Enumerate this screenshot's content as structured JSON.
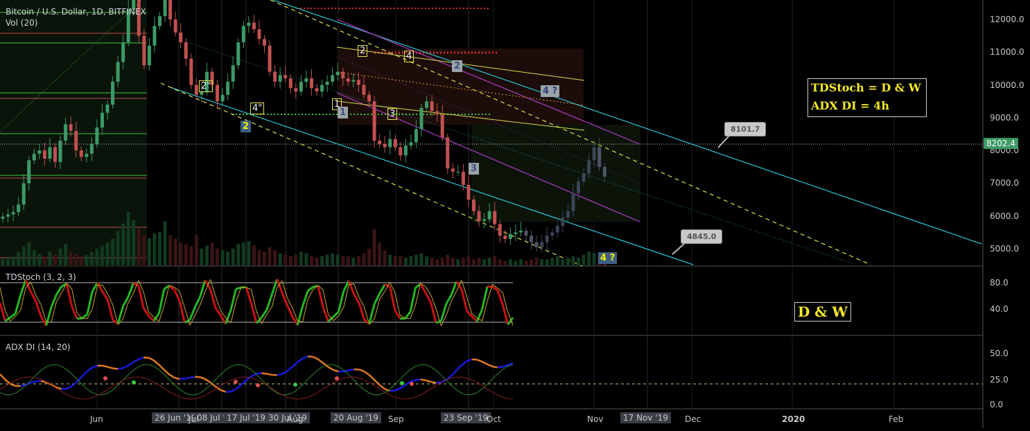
{
  "header": {
    "symbol_title": "Bitcoin / U.S. Dollar, 1D, BITFINEX",
    "vol_label": "Vol (20)"
  },
  "chart_data": [
    {
      "type": "candlestick",
      "title": "Bitcoin / U.S. Dollar, 1D, BITFINEX",
      "y_ticks": [
        "12000.0",
        "11000.0",
        "10000.0",
        "9000.0",
        "8000.0",
        "7000.0",
        "6000.0",
        "5000.0"
      ],
      "ylim": [
        4600,
        12500
      ],
      "last_price": "8202.4",
      "callouts": [
        "8101.7",
        "4845.0"
      ],
      "wave_labels": [
        "2\"",
        "4\"",
        "2",
        "1",
        "1",
        "2",
        "3",
        "4",
        "2",
        "3",
        "4 ?",
        "4 ?"
      ],
      "annotation_box": [
        "TDStoch = D & W",
        "ADX DI = 4h"
      ],
      "series_close": [
        5980,
        6050,
        6120,
        6350,
        7000,
        7700,
        7900,
        8000,
        7750,
        8100,
        7650,
        8300,
        8800,
        8600,
        8000,
        7800,
        7900,
        8200,
        8700,
        9150,
        9400,
        10100,
        10700,
        11300,
        12300,
        12700,
        11500,
        10600,
        11200,
        11800,
        12100,
        12600,
        12000,
        11600,
        11300,
        10800,
        10000,
        9700,
        9800,
        10400,
        10000,
        9500,
        9700,
        10100,
        10600,
        11300,
        11800,
        11900,
        11700,
        11400,
        11200,
        10400,
        10100,
        10300,
        10200,
        9900,
        9800,
        10100,
        10200,
        9900,
        9800,
        10000,
        10100,
        10300,
        10400,
        10200,
        10100,
        10150,
        10000,
        9700,
        9500,
        8300,
        8200,
        8100,
        8350,
        8100,
        7850,
        8150,
        8250,
        8650,
        9300,
        9500,
        9200,
        9100,
        8400,
        7450,
        7350,
        7350,
        6950,
        6500,
        6150,
        5850,
        5900,
        6150,
        5750,
        5400,
        5300,
        5450,
        5500,
        5550,
        5400,
        5200,
        5050,
        5200,
        5400,
        5500,
        5700,
        5950,
        6150,
        6700,
        7050,
        7300,
        7700,
        8100,
        7500,
        7200
      ],
      "volume": [
        8,
        10,
        12,
        18,
        25,
        30,
        20,
        15,
        12,
        18,
        14,
        22,
        28,
        18,
        15,
        12,
        14,
        18,
        22,
        26,
        30,
        35,
        45,
        55,
        70,
        60,
        48,
        40,
        36,
        42,
        44,
        58,
        40,
        35,
        30,
        28,
        25,
        40,
        22,
        26,
        30,
        22,
        20,
        18,
        22,
        28,
        30,
        32,
        26,
        20,
        18,
        24,
        20,
        16,
        14,
        12,
        14,
        18,
        16,
        12,
        10,
        12,
        14,
        16,
        14,
        12,
        12,
        10,
        12,
        16,
        22,
        48,
        30,
        20,
        14,
        12,
        12,
        10,
        12,
        14,
        16,
        12,
        10,
        8,
        10,
        14,
        10,
        8,
        10,
        12,
        8,
        10,
        8,
        10,
        12,
        8,
        6,
        8,
        6,
        8,
        6,
        8,
        10,
        8,
        8,
        10,
        12,
        8,
        10,
        12,
        10,
        14,
        18,
        16,
        12,
        10
      ]
    },
    {
      "type": "line",
      "title": "TDStoch (3, 2, 3)",
      "y_ticks": [
        "80.0",
        "40.0"
      ],
      "annotation_box": [
        "D & W"
      ]
    },
    {
      "type": "line",
      "title": "ADX DI (14, 20)",
      "y_ticks": [
        "50.0",
        "25.0",
        "0.0"
      ]
    }
  ],
  "x_axis": {
    "ticks": [
      "Jun",
      "Jul",
      "Aug",
      "Sep",
      "Oct",
      "Nov",
      "Dec",
      "2020",
      "Feb"
    ],
    "date_chips": [
      "26 Jun '19",
      "08 Jul '19",
      "17 Jul '19",
      "30 Jul '19",
      "20 Aug '19",
      "23 Sep '19",
      "17 Nov '19"
    ]
  },
  "colors": {
    "bull_candle": "#3c9a66",
    "bear_candle": "#c25050",
    "cyan_channel": "#2bc7d6",
    "purple_channel": "#b03cc9",
    "yellow_dash": "#e3e348",
    "td_green": "#22b922",
    "td_red": "#cc1111",
    "adx_blue": "#1a1ae0",
    "adx_orange": "#e07a20"
  }
}
